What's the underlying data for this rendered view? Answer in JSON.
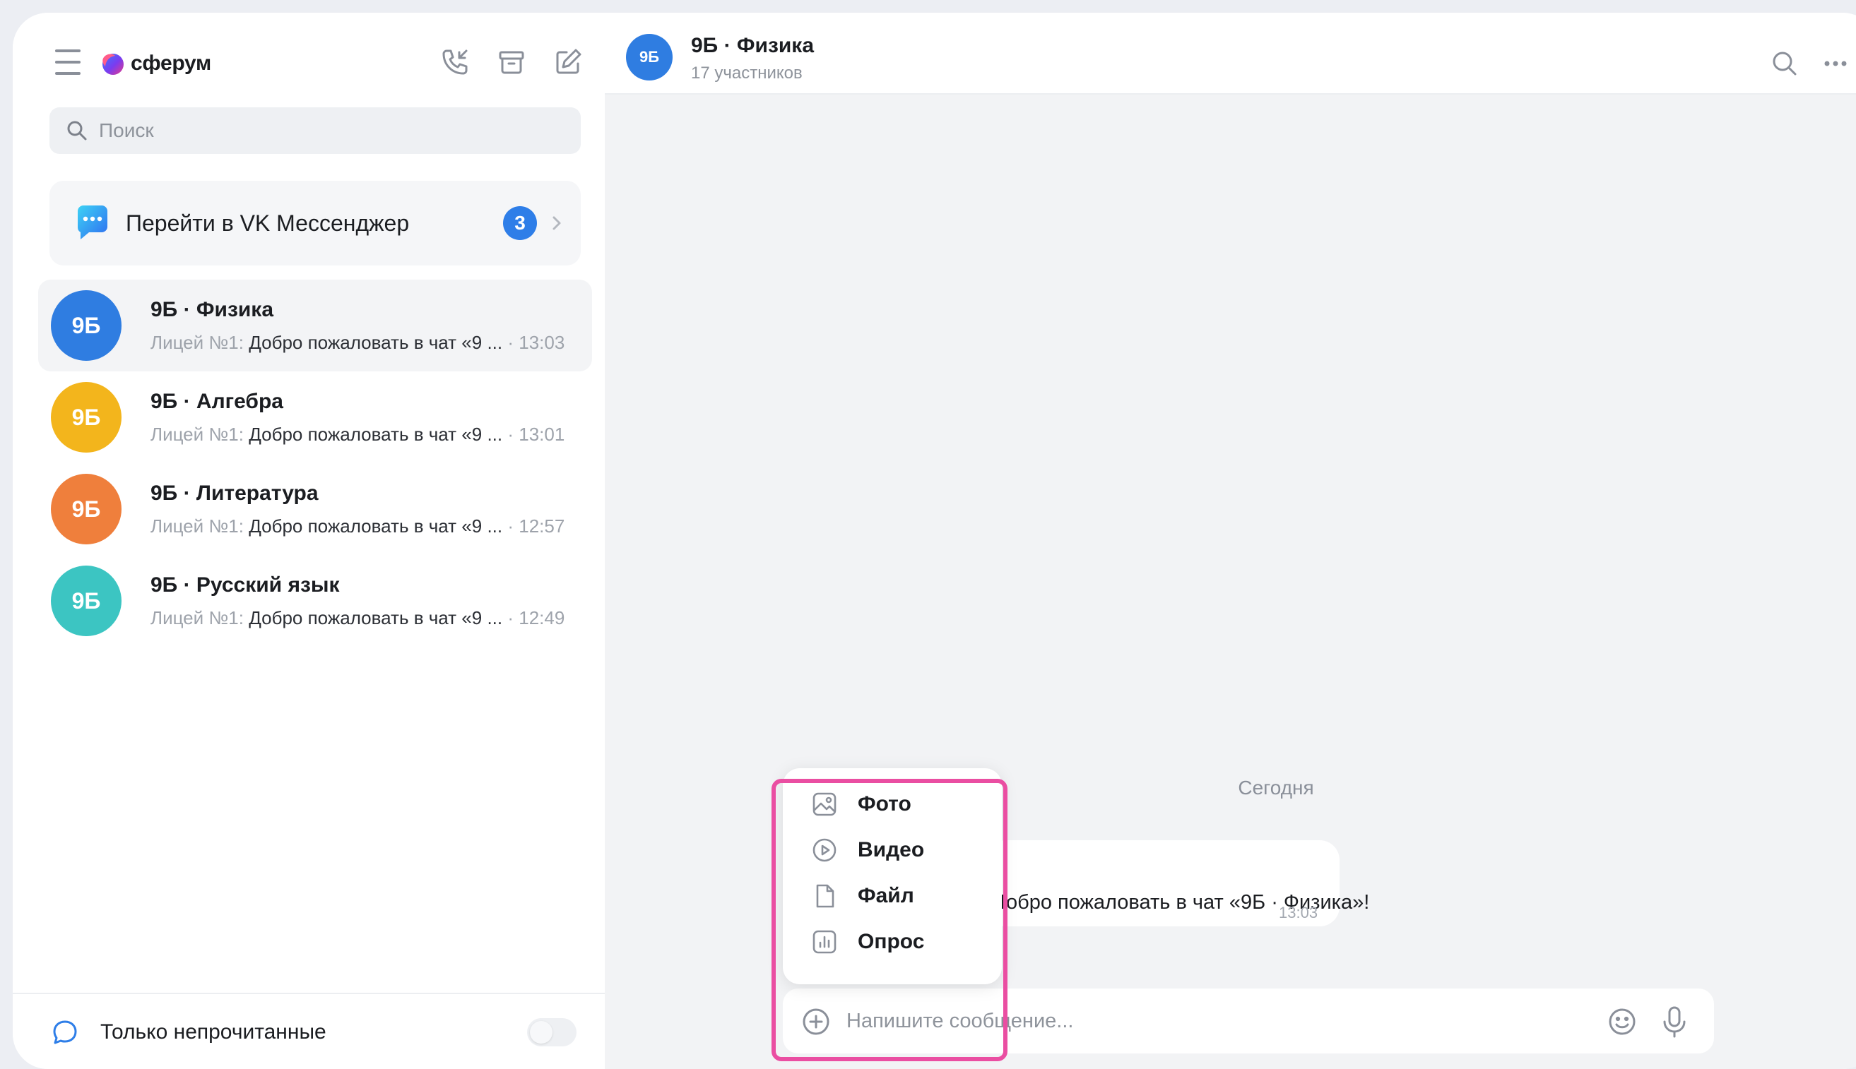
{
  "app": {
    "name": "сферум"
  },
  "colors": {
    "accent": "#2e7ee8",
    "highlight": "#ea4ea2",
    "avatar_blue": "#2f7de1",
    "avatar_yellow": "#f3b51c",
    "avatar_orange": "#ef7f3c",
    "avatar_teal": "#3cc5c2"
  },
  "sidebar": {
    "search": {
      "placeholder": "Поиск"
    },
    "vk_banner": {
      "label": "Перейти в VK Мессенджер",
      "badge": "3"
    },
    "chats": [
      {
        "avatar_text": "9Б",
        "avatar_color": "#2f7de1",
        "title": "9Б · Физика",
        "sender": "Лицей №1:",
        "preview": "Добро пожаловать в чат «9 ...",
        "time": "13:03",
        "active": true
      },
      {
        "avatar_text": "9Б",
        "avatar_color": "#f3b51c",
        "title": "9Б · Алгебра",
        "sender": "Лицей №1:",
        "preview": "Добро пожаловать в чат «9 ...",
        "time": "13:01",
        "active": false
      },
      {
        "avatar_text": "9Б",
        "avatar_color": "#ef7f3c",
        "title": "9Б · Литература",
        "sender": "Лицей №1:",
        "preview": "Добро пожаловать в чат «9 ...",
        "time": "12:57",
        "active": false
      },
      {
        "avatar_text": "9Б",
        "avatar_color": "#3cc5c2",
        "title": "9Б · Русский язык",
        "sender": "Лицей №1:",
        "preview": "Добро пожаловать в чат «9 ...",
        "time": "12:49",
        "active": false
      }
    ],
    "footer": {
      "label": "Только непрочитанные",
      "toggle_on": false
    }
  },
  "main": {
    "header": {
      "avatar_text": "9Б",
      "title": "9Б · Физика",
      "subtitle": "17 участников"
    },
    "date_separator": "Сегодня",
    "message": {
      "text": "Добро пожаловать в чат «9Б · Физика»!",
      "time": "13:03"
    },
    "composer": {
      "placeholder": "Напишите сообщение..."
    },
    "attach_menu": [
      {
        "label": "Фото",
        "icon": "photo-icon"
      },
      {
        "label": "Видео",
        "icon": "video-icon"
      },
      {
        "label": "Файл",
        "icon": "file-icon"
      },
      {
        "label": "Опрос",
        "icon": "poll-icon"
      }
    ]
  }
}
